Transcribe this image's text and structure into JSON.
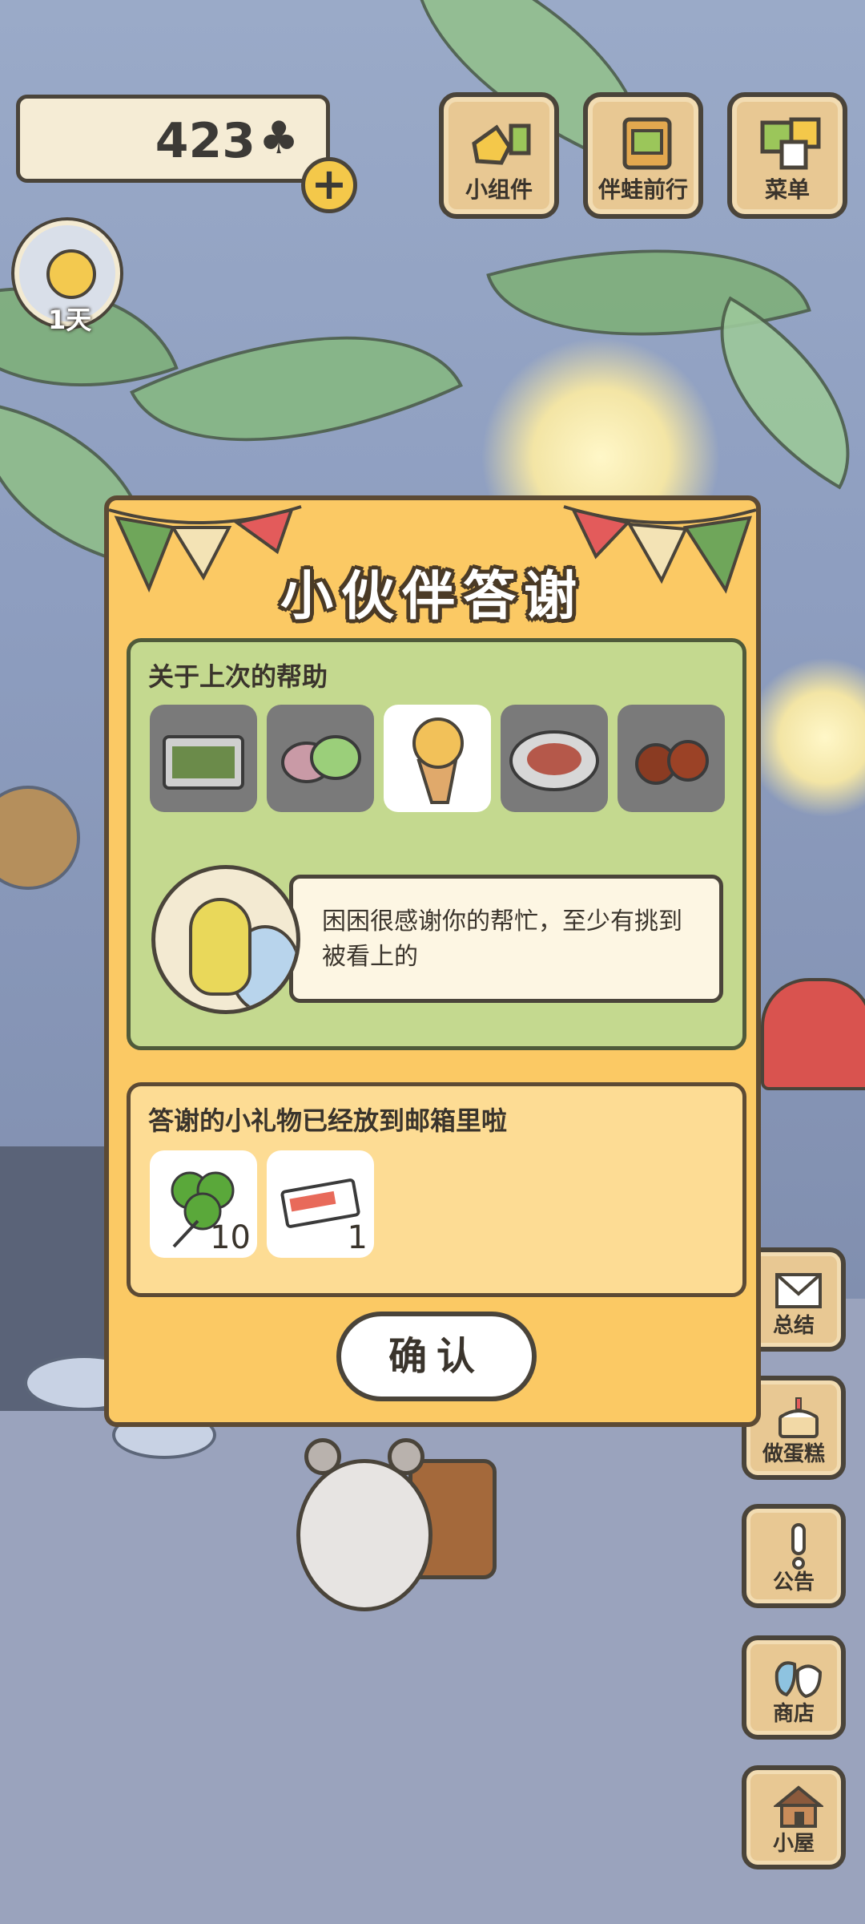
{
  "hud": {
    "clover_count": "423",
    "clover_icon": "clover-icon",
    "add_icon": "plus-icon",
    "days_label": "1天"
  },
  "top_buttons": [
    {
      "label": "小组件",
      "icon": "widget-icon"
    },
    {
      "label": "伴蛙前行",
      "icon": "journey-icon"
    },
    {
      "label": "菜单",
      "icon": "menu-icon"
    }
  ],
  "side_buttons": [
    {
      "label": "总结",
      "icon": "letter-icon"
    },
    {
      "label": "做蛋糕",
      "icon": "cake-icon"
    },
    {
      "label": "公告",
      "icon": "exclamation-icon"
    },
    {
      "label": "商店",
      "icon": "shop-bag-icon"
    },
    {
      "label": "小屋",
      "icon": "house-icon"
    }
  ],
  "dialog": {
    "title": "小伙伴答谢",
    "help_section": {
      "label": "关于上次的帮助",
      "items": [
        {
          "name": "bento-box",
          "selected": false
        },
        {
          "name": "mochi",
          "selected": false
        },
        {
          "name": "egg-waffle",
          "selected": true
        },
        {
          "name": "salad-plate",
          "selected": false
        },
        {
          "name": "chestnuts",
          "selected": false
        }
      ],
      "message": "困困很感谢你的帮忙，至少有挑到被看上的"
    },
    "gift_section": {
      "label": "答谢的小礼物已经放到邮箱里啦",
      "gifts": [
        {
          "name": "clover",
          "qty": "10"
        },
        {
          "name": "ticket",
          "qty": "1"
        }
      ]
    },
    "confirm_label": "确认"
  },
  "colors": {
    "dialog_bg": "#fbc964",
    "help_bg": "#c4d98f",
    "gift_bg": "#fddc94",
    "outline": "#4a443a"
  }
}
